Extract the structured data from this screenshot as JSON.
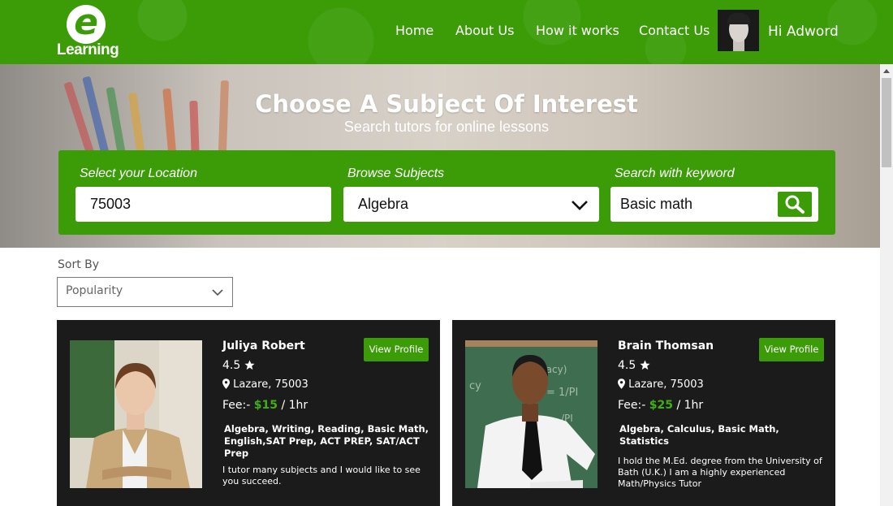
{
  "header": {
    "logo_text": "Learning",
    "logo_letter": "e",
    "nav": [
      {
        "label": "Home"
      },
      {
        "label": "About Us"
      },
      {
        "label": "How it works"
      },
      {
        "label": "Contact Us"
      }
    ],
    "user_greeting": "Hi Adword",
    "brand_color": "#3b9c08"
  },
  "hero": {
    "title": "Choose A Subject Of Interest",
    "subtitle": "Search tutors for online lessons"
  },
  "search": {
    "location_label": "Select your Location",
    "location_value": "75003",
    "subject_label": "Browse Subjects",
    "subject_value": "Algebra",
    "keyword_label": "Search with keyword",
    "keyword_value": "Basic math",
    "search_icon": "search-icon",
    "dropdown_icon": "chevron-down-icon"
  },
  "sort": {
    "label": "Sort By",
    "value": "Popularity"
  },
  "tutors": [
    {
      "name": "Juliya Robert",
      "rating": "4.5",
      "location": "Lazare, 75003",
      "fee_prefix": "Fee:-",
      "price": "$15",
      "fee_suffix": "/ 1hr",
      "subjects": "Algebra, Writing, Reading, Basic Math, English,SAT Prep, ACT PREP, SAT/ACT Prep",
      "bio": "I tutor many subjects and I would like to see you succeed.",
      "view_label": "View Profile"
    },
    {
      "name": "Brain Thomsan",
      "rating": "4.5",
      "location": "Lazare, 75003",
      "fee_prefix": "Fee:-",
      "price": "$25",
      "fee_suffix": "/ 1hr",
      "subjects": "Algebra, Calculus, Basic Math, Statistics",
      "bio": "I hold the M.Ed. degree from the University of Bath (U.K.) I am a highly experienced Math/Physics Tutor",
      "view_label": "View Profile"
    }
  ]
}
